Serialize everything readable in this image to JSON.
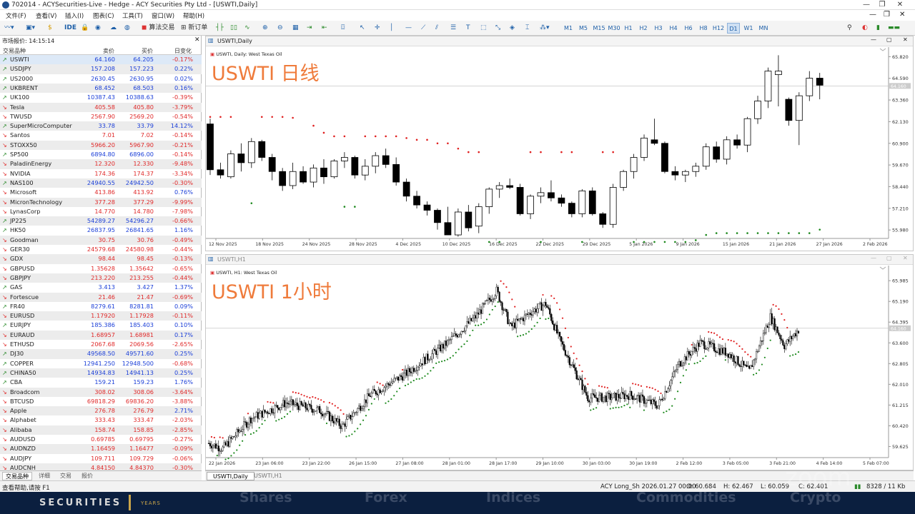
{
  "window": {
    "title": "702014 - ACYSecurities-Live - Hedge - ACY Securities Pty Ltd - [USWTI,Daily]"
  },
  "menu": [
    "文件(F)",
    "查看(V)",
    "插入(I)",
    "图表(C)",
    "工具(T)",
    "窗口(W)",
    "帮助(H)"
  ],
  "toolbar": {
    "ide_label": "IDE",
    "algo_label": "算法交易",
    "new_order_label": "新订单",
    "timeframes": [
      "M1",
      "M5",
      "M15",
      "M30",
      "H1",
      "H2",
      "H3",
      "H4",
      "H6",
      "H8",
      "H12",
      "D1",
      "W1",
      "MN"
    ],
    "active_timeframe": "D1"
  },
  "watchlist": {
    "title": "市场报价: 14:15:14",
    "headers": {
      "symbol": "交易品种",
      "bid": "卖价",
      "ask": "买价",
      "change": "日变化"
    },
    "rows": [
      {
        "s": "USWTI",
        "b": "64.160",
        "a": "64.205",
        "c": "-0.17%",
        "d": "up"
      },
      {
        "s": "USDJPY",
        "b": "157.208",
        "a": "157.223",
        "c": "0.22%",
        "d": "up"
      },
      {
        "s": "US2000",
        "b": "2630.45",
        "a": "2630.95",
        "c": "0.02%",
        "d": "up"
      },
      {
        "s": "UKBRENT",
        "b": "68.452",
        "a": "68.503",
        "c": "0.16%",
        "d": "up"
      },
      {
        "s": "UK100",
        "b": "10387.43",
        "a": "10388.63",
        "c": "-0.39%",
        "d": "up"
      },
      {
        "s": "Tesla",
        "b": "405.58",
        "a": "405.80",
        "c": "-3.79%",
        "d": "dn"
      },
      {
        "s": "TWUSD",
        "b": "2567.90",
        "a": "2569.20",
        "c": "-0.54%",
        "d": "dn"
      },
      {
        "s": "SuperMicroComputer",
        "b": "33.78",
        "a": "33.79",
        "c": "14.12%",
        "d": "up"
      },
      {
        "s": "Santos",
        "b": "7.01",
        "a": "7.02",
        "c": "-0.14%",
        "d": "dn"
      },
      {
        "s": "STOXX50",
        "b": "5966.20",
        "a": "5967.90",
        "c": "-0.21%",
        "d": "dn"
      },
      {
        "s": "SP500",
        "b": "6894.80",
        "a": "6896.00",
        "c": "-0.14%",
        "d": "up"
      },
      {
        "s": "PaladinEnergy",
        "b": "12.320",
        "a": "12.330",
        "c": "-9.48%",
        "d": "dn"
      },
      {
        "s": "NVIDIA",
        "b": "174.36",
        "a": "174.37",
        "c": "-3.34%",
        "d": "dn"
      },
      {
        "s": "NAS100",
        "b": "24940.55",
        "a": "24942.50",
        "c": "-0.30%",
        "d": "up"
      },
      {
        "s": "Microsoft",
        "b": "413.86",
        "a": "413.92",
        "c": "0.76%",
        "d": "dn"
      },
      {
        "s": "MicronTechnology",
        "b": "377.28",
        "a": "377.29",
        "c": "-9.99%",
        "d": "dn"
      },
      {
        "s": "LynasCorp",
        "b": "14.770",
        "a": "14.780",
        "c": "-7.98%",
        "d": "dn"
      },
      {
        "s": "JP225",
        "b": "54289.27",
        "a": "54296.27",
        "c": "-0.66%",
        "d": "up"
      },
      {
        "s": "HK50",
        "b": "26837.95",
        "a": "26841.65",
        "c": "1.16%",
        "d": "up"
      },
      {
        "s": "Goodman",
        "b": "30.75",
        "a": "30.76",
        "c": "-0.49%",
        "d": "dn"
      },
      {
        "s": "GER30",
        "b": "24579.68",
        "a": "24580.98",
        "c": "-0.44%",
        "d": "dn"
      },
      {
        "s": "GDX",
        "b": "98.44",
        "a": "98.45",
        "c": "-0.13%",
        "d": "dn"
      },
      {
        "s": "GBPUSD",
        "b": "1.35628",
        "a": "1.35642",
        "c": "-0.65%",
        "d": "dn"
      },
      {
        "s": "GBPJPY",
        "b": "213.220",
        "a": "213.255",
        "c": "-0.44%",
        "d": "dn"
      },
      {
        "s": "GAS",
        "b": "3.413",
        "a": "3.427",
        "c": "1.37%",
        "d": "up"
      },
      {
        "s": "Fortescue",
        "b": "21.46",
        "a": "21.47",
        "c": "-0.69%",
        "d": "dn"
      },
      {
        "s": "FR40",
        "b": "8279.61",
        "a": "8281.81",
        "c": "0.09%",
        "d": "up"
      },
      {
        "s": "EURUSD",
        "b": "1.17920",
        "a": "1.17928",
        "c": "-0.11%",
        "d": "dn"
      },
      {
        "s": "EURJPY",
        "b": "185.386",
        "a": "185.403",
        "c": "0.10%",
        "d": "up"
      },
      {
        "s": "EURAUD",
        "b": "1.68957",
        "a": "1.68981",
        "c": "0.17%",
        "d": "dn"
      },
      {
        "s": "ETHUSD",
        "b": "2067.68",
        "a": "2069.56",
        "c": "-2.65%",
        "d": "dn"
      },
      {
        "s": "DJ30",
        "b": "49568.50",
        "a": "49571.60",
        "c": "0.25%",
        "d": "up"
      },
      {
        "s": "COPPER",
        "b": "12941.250",
        "a": "12948.500",
        "c": "-0.68%",
        "d": "up"
      },
      {
        "s": "CHINA50",
        "b": "14934.83",
        "a": "14941.13",
        "c": "0.25%",
        "d": "up"
      },
      {
        "s": "CBA",
        "b": "159.21",
        "a": "159.23",
        "c": "1.76%",
        "d": "up"
      },
      {
        "s": "Broadcom",
        "b": "308.02",
        "a": "308.06",
        "c": "-3.64%",
        "d": "dn"
      },
      {
        "s": "BTCUSD",
        "b": "69818.29",
        "a": "69836.20",
        "c": "-3.88%",
        "d": "dn"
      },
      {
        "s": "Apple",
        "b": "276.78",
        "a": "276.79",
        "c": "2.71%",
        "d": "dn"
      },
      {
        "s": "Alphabet",
        "b": "333.43",
        "a": "333.47",
        "c": "-2.03%",
        "d": "dn"
      },
      {
        "s": "Alibaba",
        "b": "158.74",
        "a": "158.85",
        "c": "-2.85%",
        "d": "dn"
      },
      {
        "s": "AUDUSD",
        "b": "0.69785",
        "a": "0.69795",
        "c": "-0.27%",
        "d": "dn"
      },
      {
        "s": "AUDNZD",
        "b": "1.16459",
        "a": "1.16477",
        "c": "-0.09%",
        "d": "dn"
      },
      {
        "s": "AUDJPY",
        "b": "109.711",
        "a": "109.729",
        "c": "-0.06%",
        "d": "dn"
      },
      {
        "s": "AUDCNH",
        "b": "4.84150",
        "a": "4.84370",
        "c": "-0.30%",
        "d": "dn"
      }
    ],
    "tabs": [
      "交易品种",
      "详细",
      "交易",
      "报价"
    ]
  },
  "chart_data": [
    {
      "type": "candlestick",
      "window_title": "USWTI,Daily",
      "overlay_title": "USWTI 日线",
      "symbol_label": "USWTI, Daily:  West Texas Oil",
      "x_ticks": [
        "12 Nov 2025",
        "18 Nov 2025",
        "24 Nov 2025",
        "28 Nov 2025",
        "4 Dec 2025",
        "10 Dec 2025",
        "16 Dec 2025",
        "22 Dec 2025",
        "29 Dec 2025",
        "5 Jan 2026",
        "9 Jan 2026",
        "15 Jan 2026",
        "21 Jan 2026",
        "27 Jan 2026",
        "2 Feb 2026"
      ],
      "y_ticks": [
        65.82,
        64.59,
        63.36,
        62.13,
        60.9,
        59.67,
        58.44,
        57.21,
        55.98
      ],
      "ylim": [
        55.5,
        66.2
      ],
      "current_price_label": "64.160",
      "candles": [
        [
          62.0,
          62.3,
          59.1,
          59.4
        ],
        [
          59.4,
          59.8,
          58.9,
          59.1
        ],
        [
          59.0,
          60.5,
          58.9,
          60.3
        ],
        [
          60.3,
          60.9,
          59.3,
          59.8
        ],
        [
          59.8,
          61.2,
          59.5,
          61.0
        ],
        [
          61.0,
          61.1,
          59.9,
          60.1
        ],
        [
          60.1,
          60.3,
          58.8,
          59.3
        ],
        [
          59.3,
          59.5,
          58.2,
          58.5
        ],
        [
          58.5,
          59.8,
          58.3,
          59.3
        ],
        [
          59.3,
          59.6,
          58.6,
          58.7
        ],
        [
          58.7,
          59.7,
          58.4,
          59.5
        ],
        [
          59.5,
          60.0,
          58.6,
          59.0
        ],
        [
          59.0,
          60.0,
          58.9,
          59.9
        ],
        [
          59.9,
          60.4,
          59.5,
          60.1
        ],
        [
          60.1,
          60.2,
          58.9,
          59.1
        ],
        [
          59.1,
          60.0,
          58.8,
          59.6
        ],
        [
          59.6,
          60.4,
          59.2,
          60.2
        ],
        [
          60.2,
          60.6,
          59.5,
          59.7
        ],
        [
          59.7,
          60.1,
          58.5,
          58.7
        ],
        [
          58.7,
          58.9,
          57.6,
          57.9
        ],
        [
          57.9,
          58.2,
          57.2,
          57.4
        ],
        [
          57.4,
          57.6,
          56.8,
          57.1
        ],
        [
          57.1,
          57.2,
          56.0,
          56.4
        ],
        [
          56.4,
          57.3,
          55.7,
          55.7
        ],
        [
          55.7,
          57.2,
          55.6,
          57.0
        ],
        [
          57.0,
          57.4,
          55.9,
          56.1
        ],
        [
          56.2,
          57.5,
          55.8,
          57.3
        ],
        [
          57.3,
          58.4,
          56.9,
          58.3
        ],
        [
          58.3,
          58.7,
          57.8,
          58.5
        ],
        [
          58.5,
          58.9,
          58.3,
          58.4
        ],
        [
          58.4,
          58.6,
          56.8,
          56.9
        ],
        [
          56.9,
          58.0,
          56.6,
          57.9
        ],
        [
          57.9,
          58.4,
          57.5,
          58.1
        ],
        [
          58.1,
          58.8,
          57.6,
          57.8
        ],
        [
          57.8,
          58.0,
          57.3,
          57.5
        ],
        [
          57.5,
          57.6,
          56.7,
          56.9
        ],
        [
          56.9,
          58.3,
          56.7,
          58.2
        ],
        [
          58.2,
          58.4,
          56.8,
          56.9
        ],
        [
          56.9,
          57.0,
          56.1,
          56.3
        ],
        [
          56.3,
          58.6,
          56.1,
          58.4
        ],
        [
          58.4,
          59.4,
          58.2,
          59.3
        ],
        [
          59.3,
          60.3,
          58.9,
          60.1
        ],
        [
          60.1,
          61.4,
          59.9,
          61.2
        ],
        [
          61.1,
          62.3,
          60.8,
          60.9
        ],
        [
          60.9,
          61.0,
          59.2,
          59.3
        ],
        [
          59.3,
          59.6,
          58.8,
          59.1
        ],
        [
          59.1,
          59.4,
          58.7,
          59.3
        ],
        [
          59.3,
          59.8,
          59.0,
          59.6
        ],
        [
          59.6,
          60.9,
          59.4,
          60.7
        ],
        [
          60.7,
          61.0,
          59.8,
          60.0
        ],
        [
          60.0,
          61.3,
          59.7,
          61.1
        ],
        [
          61.1,
          61.4,
          60.6,
          60.8
        ],
        [
          60.8,
          62.4,
          60.4,
          62.3
        ],
        [
          62.3,
          63.6,
          62.0,
          63.3
        ],
        [
          63.3,
          65.2,
          62.9,
          65.0
        ],
        [
          64.8,
          65.9,
          63.0,
          65.0
        ],
        [
          63.4,
          63.5,
          61.9,
          62.2
        ],
        [
          62.2,
          63.8,
          60.8,
          63.6
        ],
        [
          63.6,
          65.0,
          63.3,
          64.6
        ],
        [
          64.6,
          64.9,
          63.4,
          64.2
        ]
      ],
      "psar_above": [
        [
          0,
          62.4
        ],
        [
          1,
          62.4
        ],
        [
          2,
          62.4
        ],
        [
          5,
          62.4
        ],
        [
          6,
          62.4
        ],
        [
          7,
          62.4
        ],
        [
          8,
          62.35
        ],
        [
          10,
          61.9
        ],
        [
          11,
          61.5
        ],
        [
          12,
          61.3
        ],
        [
          13,
          61.3
        ],
        [
          15,
          61.3
        ],
        [
          16,
          61.3
        ],
        [
          17,
          61.3
        ],
        [
          18,
          61.3
        ],
        [
          19,
          61.2
        ],
        [
          20,
          61.1
        ],
        [
          21,
          61.1
        ],
        [
          22,
          60.9
        ],
        [
          23,
          60.9
        ],
        [
          24,
          60.6
        ],
        [
          25,
          60.4
        ],
        [
          26,
          60.4
        ],
        [
          31,
          60.4
        ],
        [
          32,
          60.4
        ],
        [
          34,
          60.4
        ],
        [
          35,
          60.4
        ],
        [
          38,
          60.4
        ],
        [
          39,
          60.4
        ]
      ],
      "psar_below": [
        [
          4,
          57.5
        ],
        [
          13,
          57.3
        ],
        [
          14,
          57.3
        ],
        [
          27,
          55.3
        ],
        [
          28,
          55.3
        ],
        [
          32,
          55.3
        ],
        [
          36,
          55.3
        ],
        [
          41,
          55.3
        ],
        [
          42,
          55.3
        ],
        [
          43,
          55.3
        ],
        [
          44,
          55.3
        ],
        [
          45,
          55.3
        ],
        [
          46,
          55.3
        ],
        [
          47,
          55.4
        ],
        [
          48,
          55.7
        ],
        [
          49,
          55.8
        ],
        [
          50,
          55.8
        ],
        [
          51,
          55.8
        ],
        [
          52,
          55.8
        ],
        [
          53,
          55.8
        ],
        [
          54,
          55.8
        ],
        [
          55,
          55.8
        ],
        [
          56,
          55.8
        ],
        [
          57,
          55.8
        ],
        [
          58,
          55.8
        ],
        [
          59,
          56.0
        ]
      ]
    },
    {
      "type": "candlestick",
      "window_title": "USWTI,H1",
      "overlay_title": "USWTI 1小时",
      "symbol_label": "USWTI, H1:  West Texas Oil",
      "x_ticks": [
        "22 Jan 2026",
        "23 Jan 06:00",
        "23 Jan 22:00",
        "26 Jan 15:00",
        "27 Jan 08:00",
        "28 Jan 01:00",
        "28 Jan 17:00",
        "29 Jan 10:00",
        "30 Jan 03:00",
        "30 Jan 19:00",
        "2 Feb 12:00",
        "3 Feb 05:00",
        "3 Feb 21:00",
        "4 Feb 14:00",
        "5 Feb 07:00"
      ],
      "y_ticks": [
        65.985,
        65.19,
        64.395,
        63.6,
        62.805,
        62.01,
        61.215,
        60.42,
        59.625
      ],
      "ylim": [
        59.2,
        66.4
      ],
      "current_price_label": "64.160",
      "key_points": [
        [
          0,
          59.75
        ],
        [
          10,
          59.55
        ],
        [
          30,
          60.7
        ],
        [
          55,
          61.3
        ],
        [
          80,
          61.0
        ],
        [
          95,
          60.4
        ],
        [
          115,
          61.6
        ],
        [
          140,
          62.4
        ],
        [
          170,
          63.6
        ],
        [
          190,
          64.6
        ],
        [
          205,
          65.6
        ],
        [
          215,
          64.2
        ],
        [
          230,
          64.8
        ],
        [
          240,
          65.1
        ],
        [
          250,
          63.7
        ],
        [
          270,
          61.5
        ],
        [
          285,
          61.5
        ],
        [
          300,
          61.6
        ],
        [
          320,
          61.2
        ],
        [
          335,
          62.8
        ],
        [
          350,
          63.6
        ],
        [
          370,
          63.2
        ],
        [
          385,
          62.5
        ],
        [
          400,
          64.6
        ],
        [
          410,
          63.5
        ],
        [
          420,
          64.1
        ]
      ],
      "total_bars": 420
    }
  ],
  "chart_tabs": [
    "USWTI,Daily",
    "USWTI,H1"
  ],
  "status": {
    "help": "查看帮助,请按 F1",
    "order": "ACY Long_Sh 2026.01.27 00:00",
    "open": "O: 60.684",
    "high": "H: 62.467",
    "low": "L: 60.059",
    "close": "C: 62.401",
    "traffic": "8328 / 11 Kb"
  },
  "banner": {
    "logo": "SECURITIES",
    "years": "YEARS",
    "items": [
      "Shares",
      "Forex",
      "Indices",
      "Commodities",
      "Crypto"
    ],
    "watermark": "zoom"
  },
  "colors": {
    "title_orange": "#ef7b3b",
    "up": "#1b3fd8",
    "down": "#e02a2a",
    "psar_red": "#e02020",
    "psar_green": "#1f8a1f"
  }
}
